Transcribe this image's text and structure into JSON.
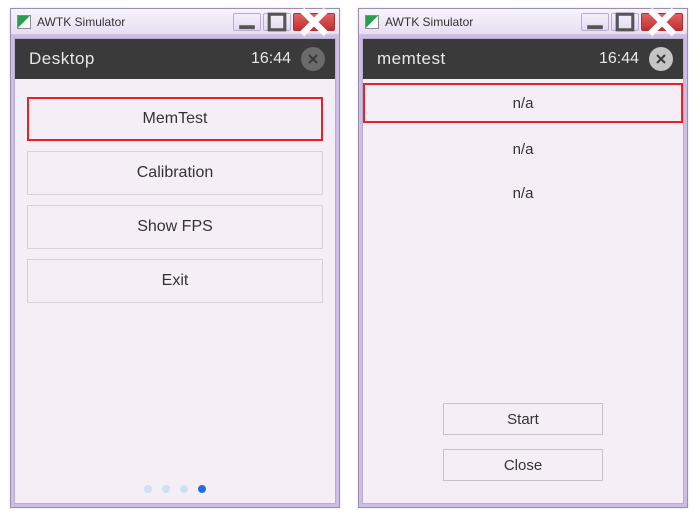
{
  "windows": [
    {
      "os_title": "AWTK Simulator",
      "app_title": "Desktop",
      "time": "16:44",
      "close_variant": "dim",
      "menu": [
        {
          "label": "MemTest",
          "highlighted": true
        },
        {
          "label": "Calibration",
          "highlighted": false
        },
        {
          "label": "Show FPS",
          "highlighted": false
        },
        {
          "label": "Exit",
          "highlighted": false
        }
      ],
      "pager_count": 4,
      "pager_active": 3
    },
    {
      "os_title": "AWTK Simulator",
      "app_title": "memtest",
      "time": "16:44",
      "close_variant": "light",
      "rows": [
        {
          "label": "n/a",
          "highlighted": true
        },
        {
          "label": "n/a",
          "highlighted": false
        },
        {
          "label": "n/a",
          "highlighted": false
        }
      ],
      "actions": {
        "start": "Start",
        "close": "Close"
      }
    }
  ]
}
